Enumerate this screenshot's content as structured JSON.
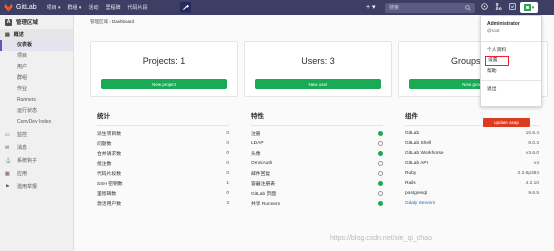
{
  "navbar": {
    "brand": "GitLab",
    "menu": [
      "项目 ▾",
      "群组 ▾",
      "活动",
      "里程碑",
      "代码片段"
    ],
    "search_placeholder": "搜索",
    "plus": "+ ▾",
    "avatar_caret": "▾"
  },
  "sidebar": {
    "header": "管理区域",
    "header_badge": "A",
    "overview_section": "概述",
    "overview_items": [
      "仪表板",
      "项目",
      "用户",
      "群组",
      "作业",
      "Runners",
      "运行状态",
      "ConvDev Index"
    ],
    "groups": [
      "监控",
      "消息",
      "系统钩子",
      "应用",
      "滥用举报"
    ]
  },
  "breadcrumb": {
    "parent": "管理区域",
    "sep": " › ",
    "current": "Dashboard"
  },
  "cards": [
    {
      "title": "Projects: 1",
      "button": "New project"
    },
    {
      "title": "Users: 3",
      "button": "New user"
    },
    {
      "title": "Groups",
      "button": "New group"
    }
  ],
  "stats": {
    "title": "统计",
    "rows": [
      {
        "label": "派生项目数",
        "value": "0"
      },
      {
        "label": "问题数",
        "value": "0"
      },
      {
        "label": "合并请求数",
        "value": "0"
      },
      {
        "label": "批注数",
        "value": "0"
      },
      {
        "label": "代码片段数",
        "value": "0"
      },
      {
        "label": "SSH 密钥数",
        "value": "1"
      },
      {
        "label": "里程碑数",
        "value": "0"
      },
      {
        "label": "激活用户数",
        "value": "3"
      }
    ]
  },
  "features": {
    "title": "特性",
    "rows": [
      {
        "label": "注册",
        "on": true
      },
      {
        "label": "LDAP",
        "on": false
      },
      {
        "label": "头像",
        "on": true
      },
      {
        "label": "OmniAuth",
        "on": false
      },
      {
        "label": "邮件回复",
        "on": false
      },
      {
        "label": "容器注册表",
        "on": true
      },
      {
        "label": "GitLab 页面",
        "on": false
      },
      {
        "label": "共享 Runners",
        "on": true
      }
    ]
  },
  "components": {
    "title": "组件",
    "update_label": "update asap",
    "rows": [
      {
        "label": "GitLab",
        "value": "10.5.4"
      },
      {
        "label": "GitLab Shell",
        "value": "6.0.3"
      },
      {
        "label": "GitLab Workhorse",
        "value": "v3.6.0"
      },
      {
        "label": "GitLab API",
        "value": "v4"
      },
      {
        "label": "Ruby",
        "value": "2.3.6p384"
      },
      {
        "label": "Rails",
        "value": "4.2.10"
      },
      {
        "label": "postgresql",
        "value": "9.6.5"
      }
    ],
    "gitaly_link": "Gitaly Servers"
  },
  "dropdown": {
    "name": "Administrator",
    "username": "@root",
    "items": [
      "个人资料",
      "设置",
      "帮助",
      "退出"
    ]
  },
  "watermark": "https://blog.csdn.net/xie_qi_chao",
  "colors": {
    "navbar": "#3d3e63",
    "accent": "#1aaa55",
    "danger": "#db3b21",
    "link": "#1b69b6"
  }
}
